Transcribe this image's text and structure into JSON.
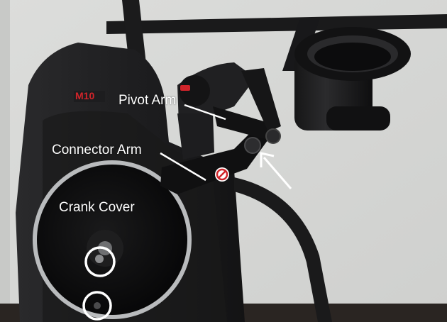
{
  "photo": {
    "subject": "exercise-machine-console-assembly",
    "colors": {
      "wall": "#d6d7d5",
      "machine_body": "#1f1f21",
      "crank_disc": "#0d0d0e",
      "crank_ring": "#b9bbbd",
      "floor": "#2a2522",
      "annotation": "#ffffff",
      "logo_accent": "#d0242a"
    }
  },
  "logo": {
    "text": "M10"
  },
  "labels": {
    "pivot_arm": "Pivot Arm",
    "connector_arm": "Connector Arm",
    "crank_cover": "Crank Cover"
  },
  "annotations": {
    "circled_items": 2,
    "arrow_target": "pivot-bolt"
  }
}
